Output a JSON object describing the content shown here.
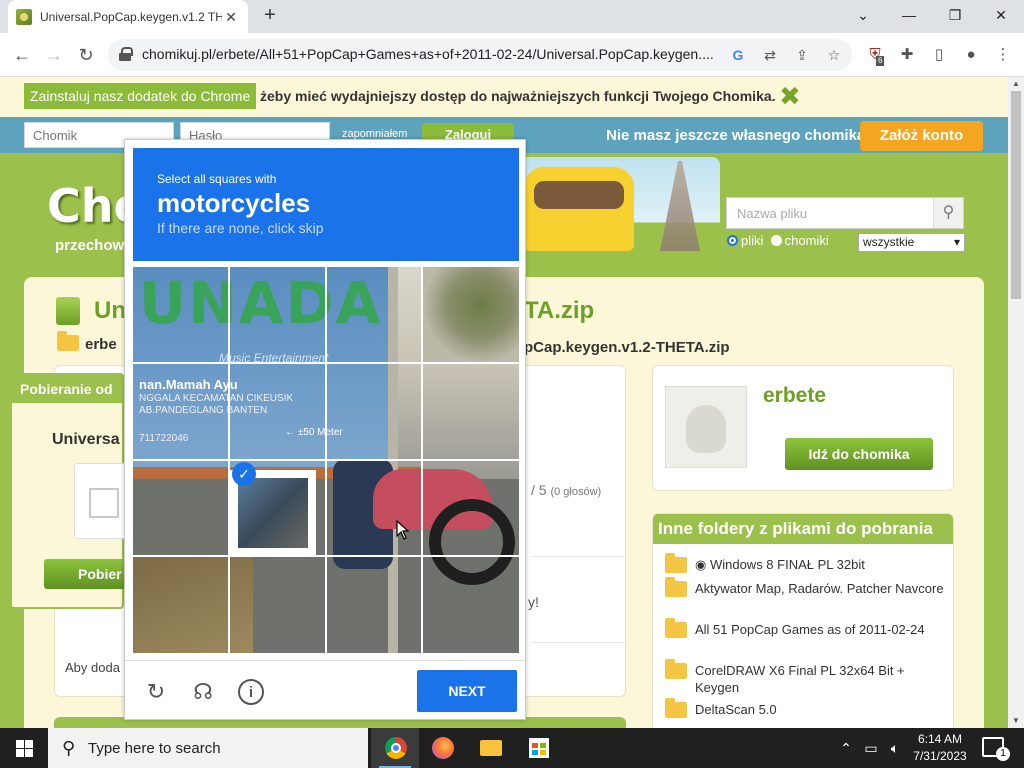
{
  "browser": {
    "tab_title": "Universal.PopCap.keygen.v1.2 TH",
    "url": "chomikuj.pl/erbete/All+51+PopCap+Games+as+of+2011-02-24/Universal.PopCap.keygen....",
    "extension_badge": "6"
  },
  "notice": {
    "install_label": "Zainstaluj nasz dodatek do Chrome",
    "text": "żeby mieć wydajniejszy dostęp do najważniejszych funkcji Twojego Chomika."
  },
  "login": {
    "user_placeholder": "Chomik",
    "password_placeholder": "Hasło",
    "forgot": "zapomniałem",
    "login_button": "Zaloguj",
    "ask": "Nie masz jeszcze własnego chomika?",
    "register_button": "Załóż konto"
  },
  "site": {
    "logo": "Cho",
    "tagline": "przechowu"
  },
  "search": {
    "placeholder": "Nazwa pliku",
    "radio_files": "pliki",
    "radio_hamsters": "chomiki",
    "type_select": "wszystkie"
  },
  "file": {
    "title_left": "Un",
    "title_right": "TA.zip",
    "crumb_left": "erbe",
    "crumb_right": "pCap.keygen.v1.2-THETA.zip",
    "rating": "/ 5",
    "votes": "(0 głosów)",
    "exclaim": "y!",
    "aby": "Aby doda"
  },
  "download_panel": {
    "header": "Pobieranie od",
    "name": "Universa",
    "button": "Pobier"
  },
  "user": {
    "name": "erbete",
    "go_button": "Idź do chomika"
  },
  "folders": {
    "header": "Inne foldery z plikami do pobrania",
    "items": [
      "◉ Windows 8 FINAŁ PL 32bit",
      "Aktywator Map, Radarów. Patcher Navcore",
      "All 51 PopCap Games as of 2011-02-24",
      "CorelDRAW X6 Final PL 32x64 Bit + Keygen",
      "DeltaScan 5.0"
    ]
  },
  "captcha": {
    "line1": "Select all squares with",
    "line2": "motorcycles",
    "line3": "If there are none, click skip",
    "next_button": "NEXT",
    "image_text": {
      "banner": "UNADA",
      "subtitle": "Music Entertainment",
      "name": "nan.Mamah Ayu",
      "addr1": "NGGALA KECAMATAN CIKEUSIK",
      "addr2": "AB.PANDEGLANG BANTEN",
      "phone": "711722046",
      "distance": "← ±50 Meter"
    }
  },
  "taskbar": {
    "search_placeholder": "Type here to search",
    "time": "6:14 AM",
    "date": "7/31/2023",
    "notification_count": "1"
  },
  "colors": {
    "site_green": "#9bc04b",
    "captcha_blue": "#1a73e8",
    "login_bar": "#5ea3bd",
    "register_orange": "#f4a620"
  }
}
